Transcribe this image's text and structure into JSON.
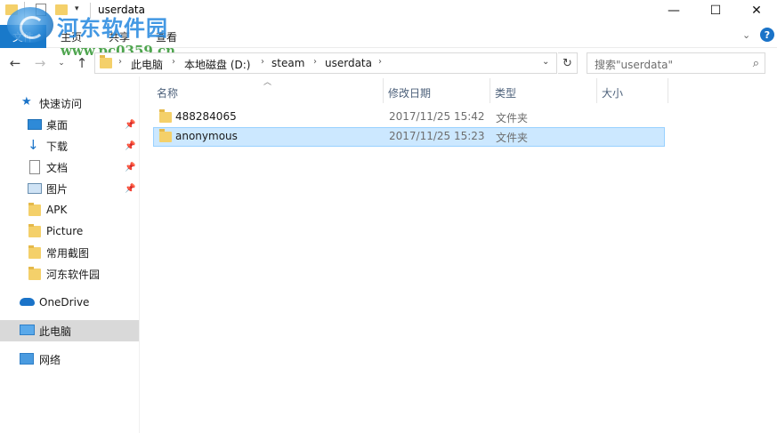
{
  "window": {
    "title": "userdata",
    "minimize": "—",
    "maximize": "☐",
    "close": "✕"
  },
  "ribbon": {
    "file_tab": "文件",
    "tabs": [
      "主页",
      "共享",
      "查看"
    ],
    "collapse_glyph": "⌄",
    "help_glyph": "?"
  },
  "watermark": {
    "title": "河东软件园",
    "url": "www.pc0359.cn"
  },
  "nav": {
    "back": "←",
    "forward": "→",
    "recent": "⌄",
    "up": "↑"
  },
  "address": {
    "crumbs": [
      "此电脑",
      "本地磁盘 (D:)",
      "steam",
      "userdata"
    ],
    "separator": "›",
    "dropdown": "⌄",
    "refresh": "↻"
  },
  "search": {
    "placeholder": "搜索\"userdata\"",
    "icon": "search-icon"
  },
  "navpane": {
    "quick_access": "快速访问",
    "items": [
      {
        "label": "桌面",
        "icon": "desktop-icon",
        "pinned": true
      },
      {
        "label": "下载",
        "icon": "download-icon",
        "pinned": true
      },
      {
        "label": "文档",
        "icon": "document-icon",
        "pinned": true
      },
      {
        "label": "图片",
        "icon": "pictures-icon",
        "pinned": true
      },
      {
        "label": "APK",
        "icon": "folder-icon",
        "pinned": false
      },
      {
        "label": "Picture",
        "icon": "folder-icon",
        "pinned": false
      },
      {
        "label": "常用截图",
        "icon": "folder-icon",
        "pinned": false
      },
      {
        "label": "河东软件园",
        "icon": "folder-icon",
        "pinned": false
      }
    ],
    "onedrive": "OneDrive",
    "this_pc": "此电脑",
    "network": "网络"
  },
  "columns": [
    "名称",
    "修改日期",
    "类型",
    "大小"
  ],
  "files": [
    {
      "name": "488284065",
      "date": "2017/11/25 15:42",
      "type": "文件夹",
      "selected": false
    },
    {
      "name": "anonymous",
      "date": "2017/11/25 15:23",
      "type": "文件夹",
      "selected": true
    }
  ],
  "colors": {
    "accent": "#1979ca",
    "selection_fill": "#cce8ff",
    "selection_border": "#99d1ff",
    "folder": "#f4d06a"
  }
}
